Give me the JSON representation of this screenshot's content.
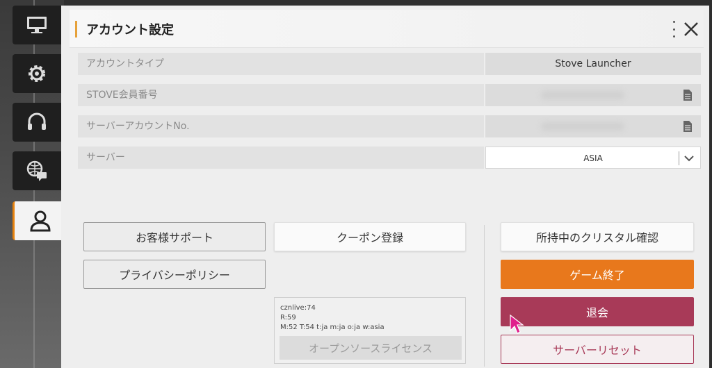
{
  "header": {
    "title": "アカウント設定"
  },
  "sidebar": {
    "items": [
      {
        "icon": "monitor-icon",
        "active": false
      },
      {
        "icon": "gear-icon",
        "active": false
      },
      {
        "icon": "headset-icon",
        "active": false
      },
      {
        "icon": "globe-chat-icon",
        "active": false
      },
      {
        "icon": "user-icon",
        "active": true
      }
    ]
  },
  "fields": {
    "account_type": {
      "label": "アカウントタイプ",
      "value": "Stove Launcher"
    },
    "member_no": {
      "label": "STOVE会員番号"
    },
    "server_account": {
      "label": "サーバーアカウントNo."
    },
    "server": {
      "label": "サーバー",
      "value": "ASIA"
    }
  },
  "buttons": {
    "support": "お客様サポート",
    "privacy": "プライバシーポリシー",
    "coupon": "クーポン登録",
    "crystal": "所持中のクリスタル確認",
    "quit_game": "ゲーム終了",
    "withdraw": "退会",
    "server_reset": "サーバーリセット",
    "open_source": "オープンソースライセンス"
  },
  "info": {
    "line1": "cznlive:74",
    "line2": "R:59",
    "line3": "M:52 T:54 t:ja m:ja o:ja w:asia"
  },
  "colors": {
    "accent_orange": "#e8781c",
    "accent_maroon": "#a83a58",
    "header_accent": "#e6a13a"
  }
}
